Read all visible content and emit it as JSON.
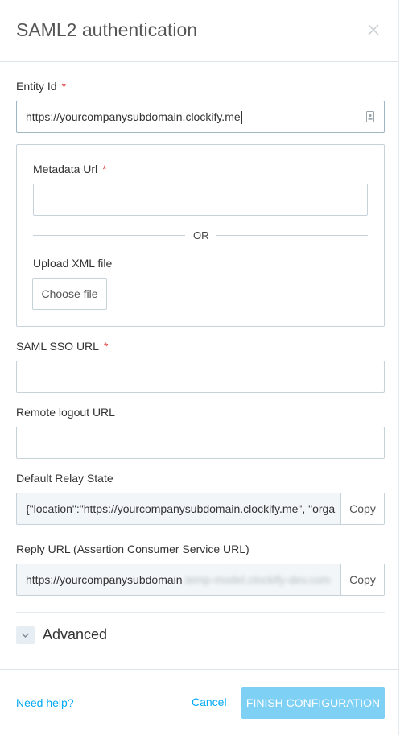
{
  "header": {
    "title": "SAML2 authentication"
  },
  "entity_id": {
    "label": "Entity Id",
    "required_mark": "*",
    "value": "https://yourcompanysubdomain.clockify.me"
  },
  "metadata": {
    "url_label": "Metadata Url",
    "required_mark": "*",
    "url_value": "",
    "or_text": "OR",
    "upload_label": "Upload XML file",
    "choose_file_label": "Choose file"
  },
  "saml_sso": {
    "label": "SAML SSO URL",
    "required_mark": "*",
    "value": ""
  },
  "remote_logout": {
    "label": "Remote logout URL",
    "value": ""
  },
  "relay_state": {
    "label": "Default Relay State",
    "value": "{\"location\":\"https://yourcompanysubdomain.clockify.me\", \"orga",
    "copy_label": "Copy"
  },
  "reply_url": {
    "label": "Reply URL (Assertion Consumer Service URL)",
    "value_visible": "https://yourcompanysubdomain",
    "value_blurred": ".temp-model.clockify-dev.com",
    "copy_label": "Copy"
  },
  "advanced": {
    "label": "Advanced",
    "expanded": false
  },
  "footer": {
    "help_label": "Need help?",
    "cancel_label": "Cancel",
    "finish_label": "FINISH CONFIGURATION"
  },
  "colors": {
    "accent": "#03a9f4",
    "finish_disabled": "#7fd0f5",
    "required": "#e54242"
  }
}
